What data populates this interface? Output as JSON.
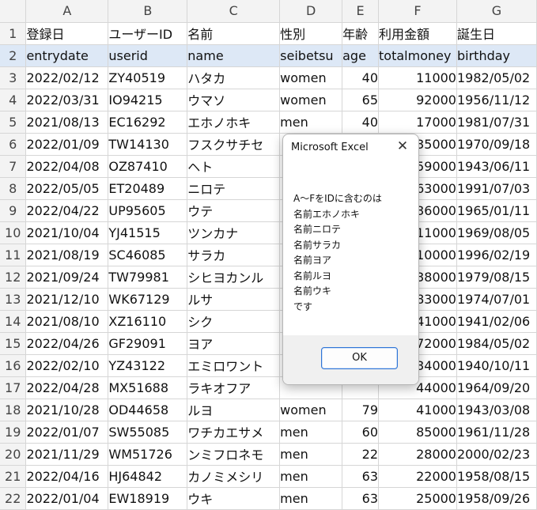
{
  "sheet": {
    "column_letters": [
      "A",
      "B",
      "C",
      "D",
      "E",
      "F",
      "G"
    ],
    "row_numbers": [
      "1",
      "2",
      "3",
      "4",
      "5",
      "6",
      "7",
      "8",
      "9",
      "10",
      "11",
      "12",
      "13",
      "14",
      "15",
      "16",
      "17",
      "18",
      "19",
      "20",
      "21",
      "22"
    ],
    "rows": [
      [
        "登録日",
        "ユーザーID",
        "名前",
        "性別",
        "年齢",
        "利用金額",
        "誕生日"
      ],
      [
        "entrydate",
        "userid",
        "name",
        "seibetsu",
        "age",
        "totalmoney",
        "birthday"
      ],
      [
        "2022/02/12",
        "ZY40519",
        "ハタカ",
        "women",
        "40",
        "11000",
        "1982/05/02"
      ],
      [
        "2022/03/31",
        "IO94215",
        "ウマソ",
        "women",
        "65",
        "92000",
        "1956/11/12"
      ],
      [
        "2021/08/13",
        "EC16292",
        "エホノホキ",
        "men",
        "40",
        "17000",
        "1981/07/31"
      ],
      [
        "2022/01/09",
        "TW14130",
        "フスクサチセ",
        "",
        "",
        "35000",
        "1970/09/18"
      ],
      [
        "2022/04/08",
        "OZ87410",
        "ヘト",
        "",
        "",
        "59000",
        "1943/06/11"
      ],
      [
        "2022/05/05",
        "ET20489",
        "ニロテ",
        "",
        "",
        "63000",
        "1991/07/03"
      ],
      [
        "2022/04/22",
        "UP95605",
        "ウテ",
        "",
        "",
        "36000",
        "1965/01/11"
      ],
      [
        "2021/10/04",
        "YJ41515",
        "ツンカナ",
        "",
        "",
        "11000",
        "1969/08/05"
      ],
      [
        "2021/08/19",
        "SC46085",
        "サラカ",
        "",
        "",
        "10000",
        "1996/02/19"
      ],
      [
        "2021/09/24",
        "TW79981",
        "シヒヨカンル",
        "",
        "",
        "38000",
        "1979/08/15"
      ],
      [
        "2021/12/10",
        "WK67129",
        "ルサ",
        "",
        "",
        "83000",
        "1974/07/01"
      ],
      [
        "2021/08/10",
        "XZ16110",
        "シク",
        "",
        "",
        "41000",
        "1941/02/06"
      ],
      [
        "2022/04/26",
        "GF29091",
        "ヨア",
        "",
        "",
        "72000",
        "1984/05/02"
      ],
      [
        "2022/02/10",
        "YZ43122",
        "エミロワント",
        "",
        "",
        "34000",
        "1940/10/11"
      ],
      [
        "2022/04/28",
        "MX51688",
        "ラキオフア",
        "",
        "",
        "44000",
        "1964/09/20"
      ],
      [
        "2021/10/28",
        "OD44658",
        "ルヨ",
        "women",
        "79",
        "41000",
        "1943/03/08"
      ],
      [
        "2022/01/07",
        "SW55085",
        "ワチカエサメ",
        "men",
        "60",
        "85000",
        "1961/11/28"
      ],
      [
        "2021/11/29",
        "WM51726",
        "ンミフロネモ",
        "men",
        "22",
        "28000",
        "2000/02/23"
      ],
      [
        "2022/04/16",
        "HJ64842",
        "カノミメシリ",
        "men",
        "63",
        "22000",
        "1958/08/15"
      ],
      [
        "2022/01/04",
        "EW18919",
        "ウキ",
        "men",
        "63",
        "25000",
        "1958/09/26"
      ]
    ]
  },
  "dialog": {
    "title": "Microsoft Excel",
    "close_glyph": "✕",
    "message_lines": [
      "A～FをIDに含むのは",
      "名前エホノホキ",
      "名前ニロテ",
      "名前サラカ",
      "名前ヨア",
      "名前ルヨ",
      "名前ウキ",
      "です"
    ],
    "ok_label": "OK"
  }
}
